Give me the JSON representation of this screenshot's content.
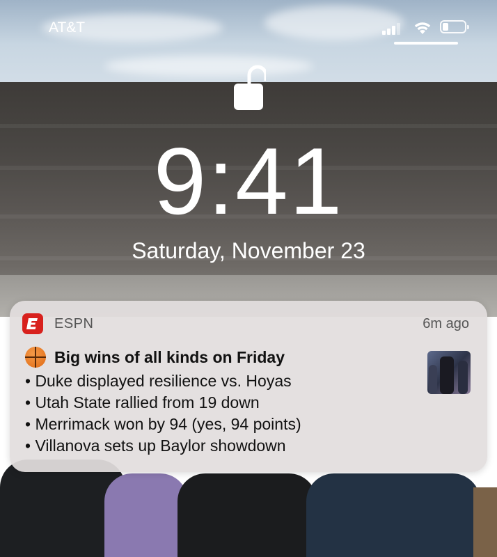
{
  "status_bar": {
    "carrier": "AT&T",
    "battery_level": 0.25
  },
  "lock_screen": {
    "time": "9:41",
    "date": "Saturday, November 23"
  },
  "notification": {
    "app_icon": "espn-logo-icon",
    "app_icon_letter": "E",
    "app_name": "ESPN",
    "age": "6m ago",
    "title": "Big wins of all kinds on Friday",
    "title_emoji_icon": "basketball-icon",
    "lines": [
      "• Duke displayed resilience vs. Hoyas",
      "• Utah State rallied from 19 down",
      "• Merrimack won by 94 (yes, 94 points)",
      "• Villanova sets up Baylor showdown"
    ]
  },
  "colors": {
    "espn_red": "#d8211d",
    "card_bg": "#e2dede"
  }
}
